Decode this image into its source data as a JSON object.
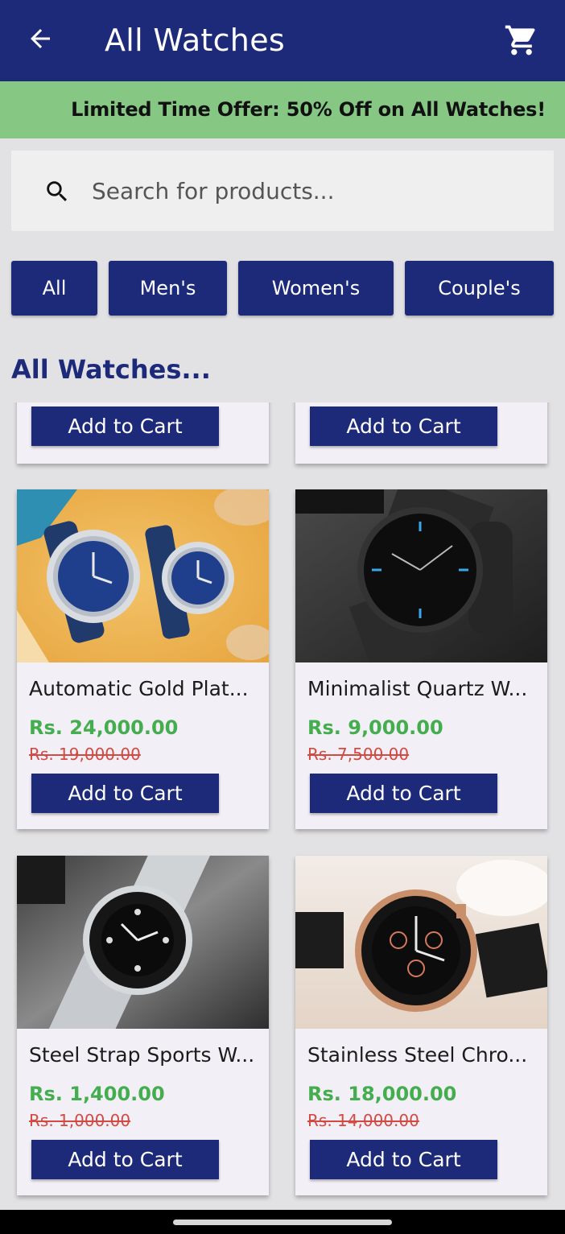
{
  "appbar": {
    "title": "All Watches",
    "back_icon": "arrow-back-icon",
    "cart_icon": "shopping-cart-icon"
  },
  "offer": {
    "text": "Limited Time Offer: 50% Off on All Watches!"
  },
  "search": {
    "placeholder": "Search for products...",
    "icon": "search-icon"
  },
  "filters": [
    "All",
    "Men's",
    "Women's",
    "Couple's"
  ],
  "section_title": "All Watches...",
  "products_partial": [
    {
      "button": "Add to Cart"
    },
    {
      "button": "Add to Cart"
    }
  ],
  "products": [
    {
      "name": "Automatic Gold Plat...",
      "price": "Rs. 24,000.00",
      "old_price": "Rs. 19,000.00",
      "button": "Add to Cart"
    },
    {
      "name": "Minimalist Quartz W...",
      "price": "Rs. 9,000.00",
      "old_price": "Rs. 7,500.00",
      "button": "Add to Cart"
    },
    {
      "name": "Steel Strap Sports W...",
      "price": "Rs. 1,400.00",
      "old_price": "Rs. 1,000.00",
      "button": "Add to Cart"
    },
    {
      "name": "Stainless Steel Chro...",
      "price": "Rs. 18,000.00",
      "old_price": "Rs. 14,000.00",
      "button": "Add to Cart"
    }
  ],
  "colors": {
    "primary": "#1d2a7a",
    "offer_bg": "#86c784",
    "price": "#44ad4e",
    "old_price": "#d24a42",
    "card_bg": "#f3eff7"
  }
}
